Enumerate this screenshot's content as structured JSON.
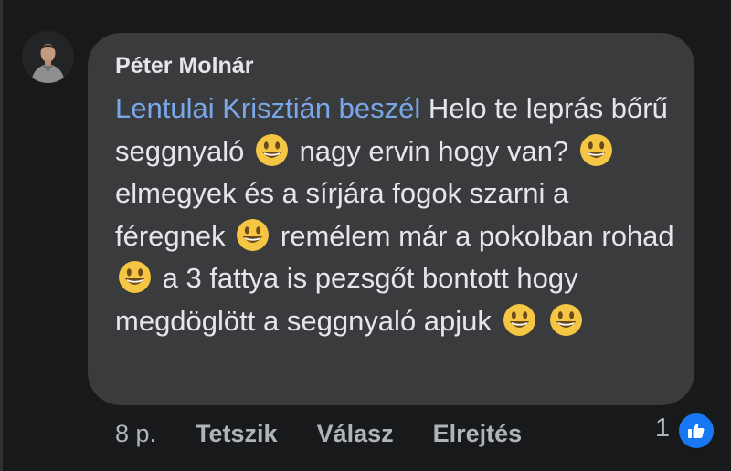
{
  "comment": {
    "author": "Péter Molnár",
    "mention": "Lentulai Krisztián beszél",
    "text_segments": [
      " Helo te leprás bőrű seggnyaló ",
      " nagy ervin hogy van? ",
      " elmegyek és a sírjára fogok szarni a féregnek ",
      " remélem már  a pokolban rohad ",
      " a 3 fattya is pezsgőt bontott hogy megdöglött a seggnyaló apjuk ",
      " "
    ],
    "emoji": "smiling-face-emoji"
  },
  "actions": {
    "time": "8 p.",
    "like_label": "Tetszik",
    "reply_label": "Válasz",
    "hide_label": "Elrejtés"
  },
  "reactions": {
    "count": "1",
    "icon": "thumbs-up-icon",
    "color": "#1877f2"
  }
}
